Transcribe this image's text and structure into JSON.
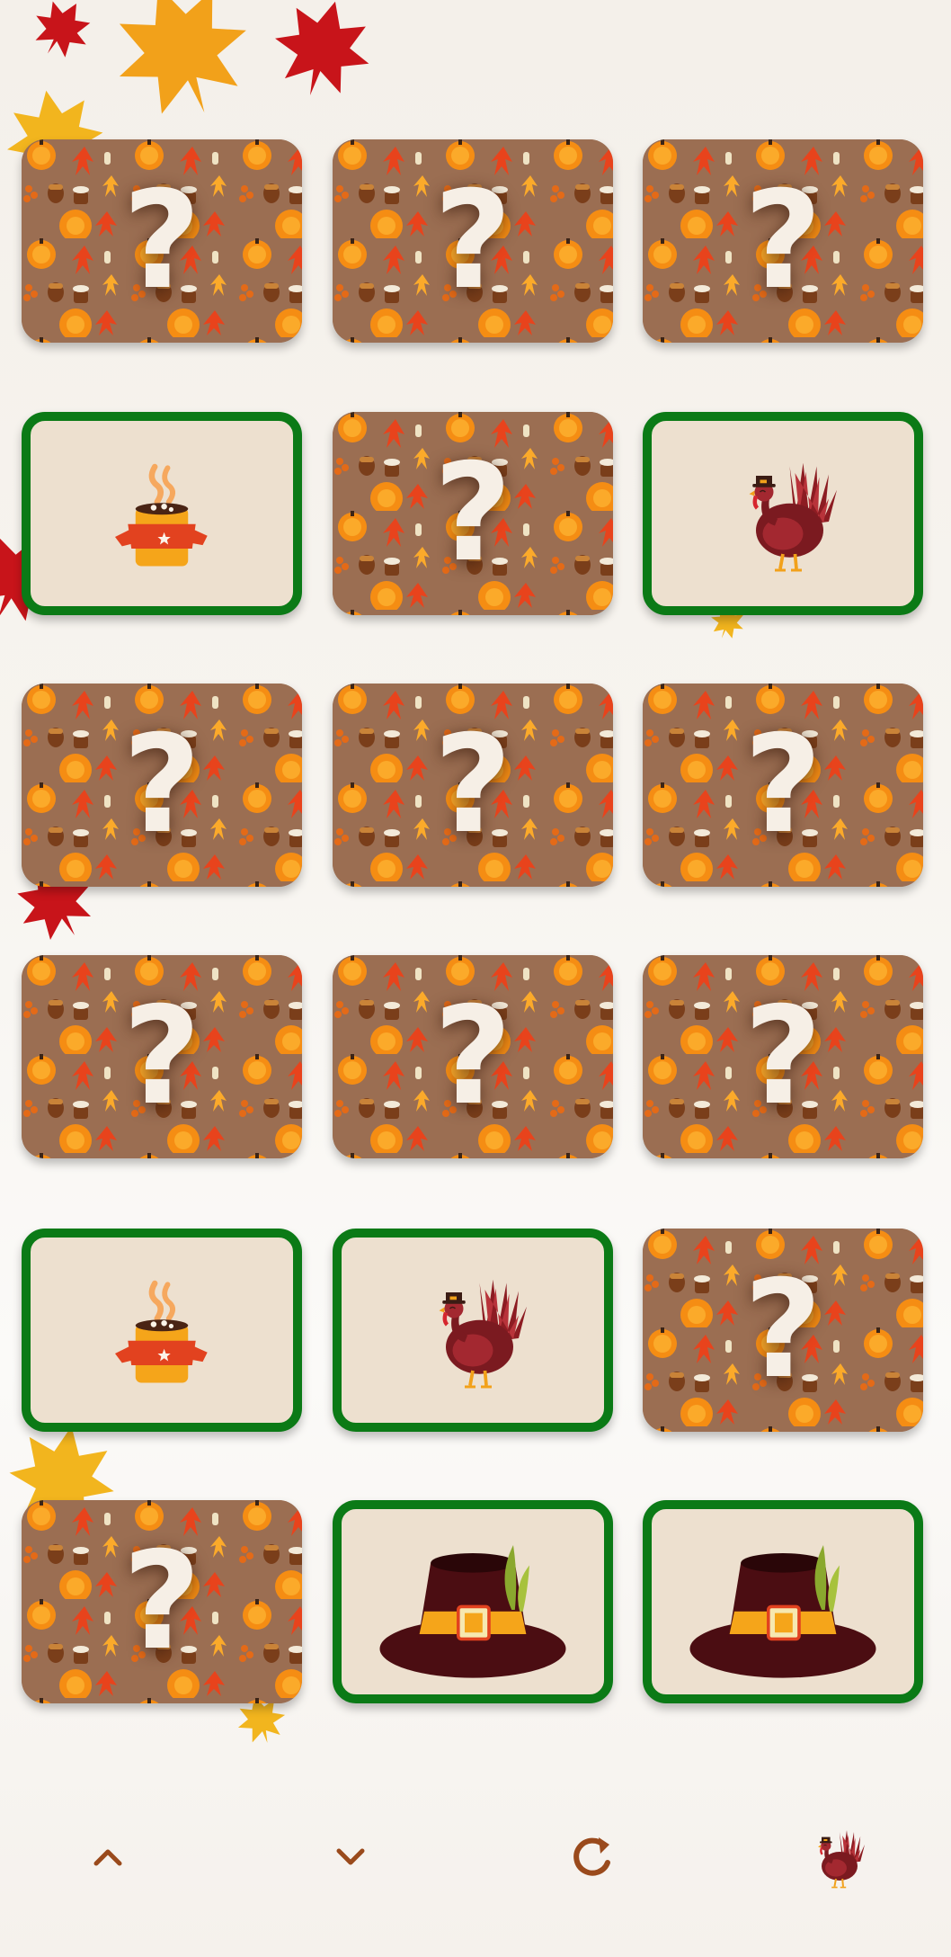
{
  "board": {
    "rows": [
      [
        {
          "state": "hidden",
          "face": "?"
        },
        {
          "state": "hidden",
          "face": "?"
        },
        {
          "state": "hidden",
          "face": "?"
        }
      ],
      [
        {
          "state": "matched",
          "icon": "cocoa-mug-icon"
        },
        {
          "state": "hidden",
          "face": "?"
        },
        {
          "state": "matched",
          "icon": "turkey-icon"
        }
      ],
      [
        {
          "state": "hidden",
          "face": "?"
        },
        {
          "state": "hidden",
          "face": "?"
        },
        {
          "state": "hidden",
          "face": "?"
        }
      ],
      [
        {
          "state": "hidden",
          "face": "?"
        },
        {
          "state": "hidden",
          "face": "?"
        },
        {
          "state": "hidden",
          "face": "?"
        }
      ],
      [
        {
          "state": "matched",
          "icon": "cocoa-mug-icon"
        },
        {
          "state": "matched",
          "icon": "turkey-icon"
        },
        {
          "state": "hidden",
          "face": "?"
        }
      ],
      [
        {
          "state": "hidden",
          "face": "?"
        },
        {
          "state": "matched",
          "icon": "pilgrim-hat-icon"
        },
        {
          "state": "matched",
          "icon": "pilgrim-hat-icon"
        }
      ]
    ],
    "match_border_color": "#0b7a16",
    "card_back_color": "#9b6e52"
  },
  "toolbar": {
    "buttons": [
      "chevron-up-icon",
      "chevron-down-icon",
      "refresh-icon",
      "turkey-icon"
    ],
    "icon_color": "#9a4a1c"
  }
}
